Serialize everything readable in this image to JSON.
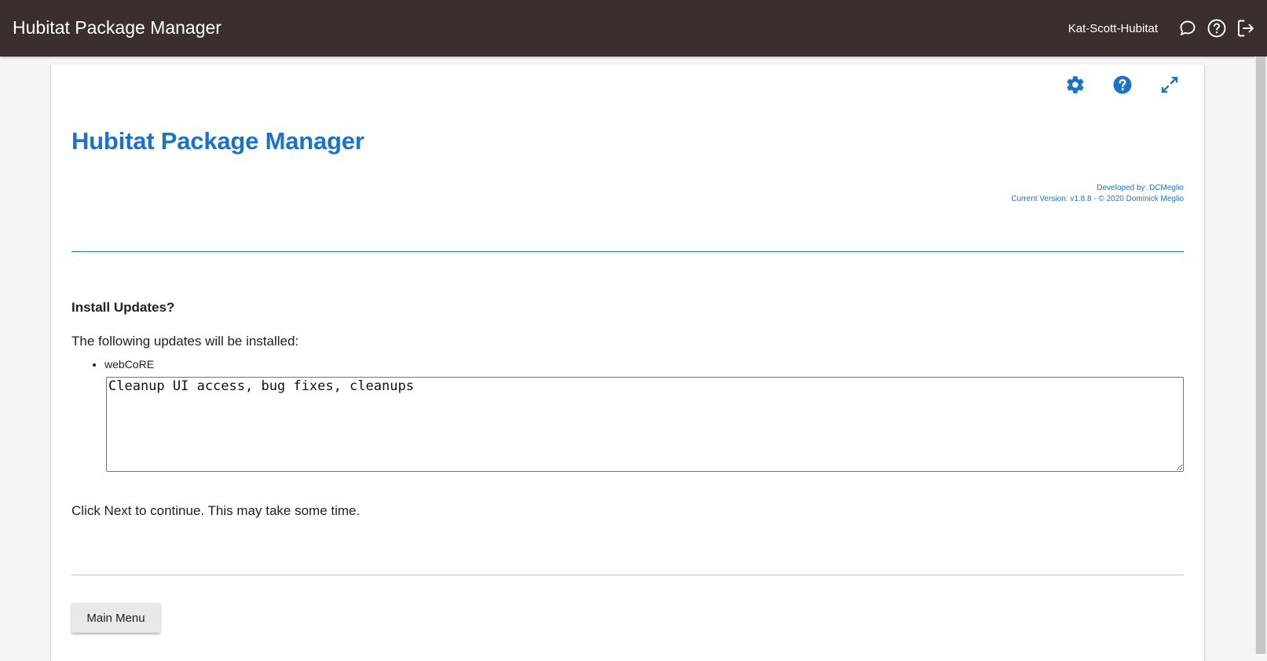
{
  "topbar": {
    "app_title": "Hubitat Package Manager",
    "hub_name": "Kat-Scott-Hubitat",
    "icons": [
      "chat-icon",
      "help-circle-icon",
      "logout-icon"
    ]
  },
  "card": {
    "toolbar_icons": [
      "gear-icon",
      "help-icon",
      "fullscreen-icon"
    ],
    "title": "Hubitat Package Manager",
    "credits": {
      "developer": "Developed by: DCMeglio",
      "version": "Current Version: v1.8.8 -  © 2020 Dominick Meglio"
    },
    "section_title": "Install Updates?",
    "intro": "The following updates will be installed:",
    "updates": [
      {
        "name": "webCoRE",
        "notes": "Cleanup UI access, bug fixes, cleanups"
      }
    ],
    "continue_text": "Click Next to continue. This may take some time.",
    "main_menu_label": "Main Menu"
  },
  "colors": {
    "topbar": "#3a2f2c",
    "accent": "#1a73c8",
    "page_bg": "#f5f5f5"
  }
}
